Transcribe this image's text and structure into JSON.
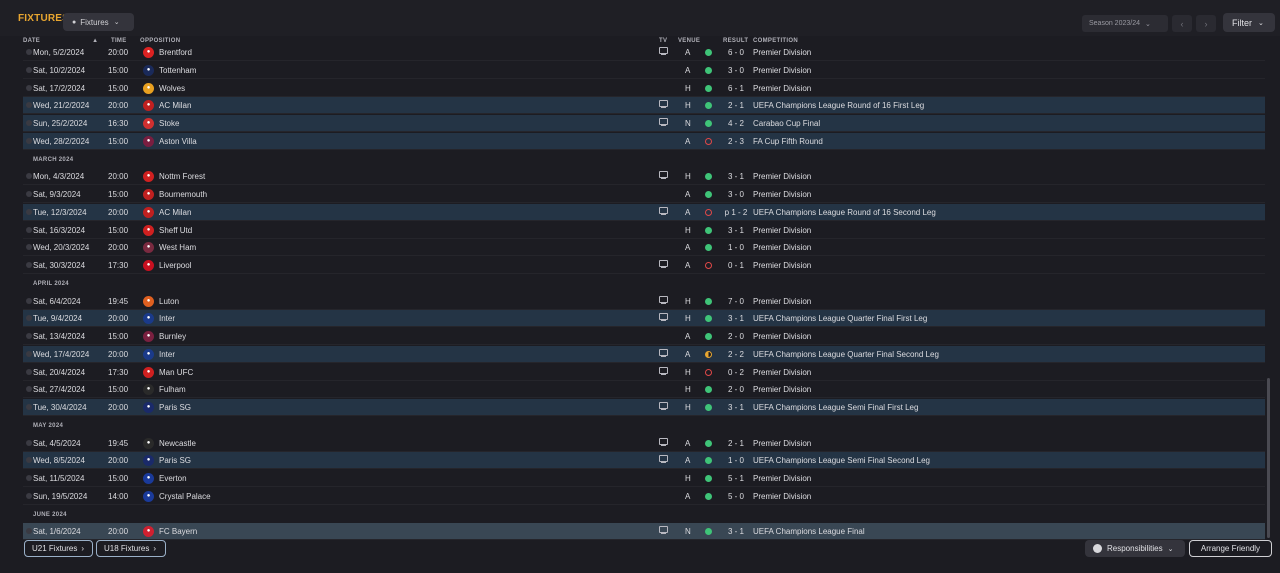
{
  "header": {
    "title": "FIXTURES",
    "view_selector": "Fixtures",
    "season": "Season 2023/24",
    "filter": "Filter"
  },
  "columns": {
    "date": "DATE",
    "time": "TIME",
    "opposition": "OPPOSITION",
    "tv": "TV",
    "venue": "VENUE",
    "result": "RESULT",
    "competition": "COMPETITION"
  },
  "rows": [
    {
      "type": "fixture",
      "date": "Mon, 5/2/2024",
      "time": "20:00",
      "opp": "Brentford",
      "crest": "#d22",
      "venue": "A",
      "result": "win",
      "score": "6 - 0",
      "comp": "Premier Division",
      "tv": true,
      "hl": false
    },
    {
      "type": "fixture",
      "date": "Sat, 10/2/2024",
      "time": "15:00",
      "opp": "Tottenham",
      "crest": "#1a2a5a",
      "venue": "A",
      "result": "win",
      "score": "3 - 0",
      "comp": "Premier Division",
      "tv": false,
      "hl": false
    },
    {
      "type": "fixture",
      "date": "Sat, 17/2/2024",
      "time": "15:00",
      "opp": "Wolves",
      "crest": "#e8a020",
      "venue": "H",
      "result": "win",
      "score": "6 - 1",
      "comp": "Premier Division",
      "tv": false,
      "hl": false
    },
    {
      "type": "fixture",
      "date": "Wed, 21/2/2024",
      "time": "20:00",
      "opp": "AC Milan",
      "crest": "#c02020",
      "venue": "H",
      "result": "win",
      "score": "2 - 1",
      "comp": "UEFA Champions League Round of 16  First Leg",
      "tv": true,
      "hl": true
    },
    {
      "type": "fixture",
      "date": "Sun, 25/2/2024",
      "time": "16:30",
      "opp": "Stoke",
      "crest": "#d03030",
      "venue": "N",
      "result": "win",
      "score": "4 - 2",
      "comp": "Carabao Cup Final",
      "tv": true,
      "hl": true
    },
    {
      "type": "fixture",
      "date": "Wed, 28/2/2024",
      "time": "15:00",
      "opp": "Aston Villa",
      "crest": "#7a1e40",
      "venue": "A",
      "result": "loss",
      "score": "2 - 3",
      "comp": "FA Cup Fifth Round",
      "tv": false,
      "hl": true
    },
    {
      "type": "month",
      "label": "MARCH 2024"
    },
    {
      "type": "fixture",
      "date": "Mon, 4/3/2024",
      "time": "20:00",
      "opp": "Nottm Forest",
      "crest": "#d02020",
      "venue": "H",
      "result": "win",
      "score": "3 - 1",
      "comp": "Premier Division",
      "tv": true,
      "hl": false
    },
    {
      "type": "fixture",
      "date": "Sat, 9/3/2024",
      "time": "15:00",
      "opp": "Bournemouth",
      "crest": "#c02020",
      "venue": "A",
      "result": "win",
      "score": "3 - 0",
      "comp": "Premier Division",
      "tv": false,
      "hl": false
    },
    {
      "type": "fixture",
      "date": "Tue, 12/3/2024",
      "time": "20:00",
      "opp": "AC Milan",
      "crest": "#c02020",
      "venue": "A",
      "result": "loss",
      "score": "p 1 - 2",
      "comp": "UEFA Champions League Round of 16  Second Leg",
      "tv": true,
      "hl": true
    },
    {
      "type": "fixture",
      "date": "Sat, 16/3/2024",
      "time": "15:00",
      "opp": "Sheff Utd",
      "crest": "#d02020",
      "venue": "H",
      "result": "win",
      "score": "3 - 1",
      "comp": "Premier Division",
      "tv": false,
      "hl": false
    },
    {
      "type": "fixture",
      "date": "Wed, 20/3/2024",
      "time": "20:00",
      "opp": "West Ham",
      "crest": "#7a2a40",
      "venue": "A",
      "result": "win",
      "score": "1 - 0",
      "comp": "Premier Division",
      "tv": false,
      "hl": false
    },
    {
      "type": "fixture",
      "date": "Sat, 30/3/2024",
      "time": "17:30",
      "opp": "Liverpool",
      "crest": "#c81020",
      "venue": "A",
      "result": "loss",
      "score": "0 - 1",
      "comp": "Premier Division",
      "tv": true,
      "hl": false
    },
    {
      "type": "month",
      "label": "APRIL 2024"
    },
    {
      "type": "fixture",
      "date": "Sat, 6/4/2024",
      "time": "19:45",
      "opp": "Luton",
      "crest": "#e06020",
      "venue": "H",
      "result": "win",
      "score": "7 - 0",
      "comp": "Premier Division",
      "tv": true,
      "hl": false
    },
    {
      "type": "fixture",
      "date": "Tue, 9/4/2024",
      "time": "20:00",
      "opp": "Inter",
      "crest": "#1a3a8a",
      "venue": "H",
      "result": "win",
      "score": "3 - 1",
      "comp": "UEFA Champions League Quarter Final First Leg",
      "tv": true,
      "hl": true
    },
    {
      "type": "fixture",
      "date": "Sat, 13/4/2024",
      "time": "15:00",
      "opp": "Burnley",
      "crest": "#7a2040",
      "venue": "A",
      "result": "win",
      "score": "2 - 0",
      "comp": "Premier Division",
      "tv": false,
      "hl": false
    },
    {
      "type": "fixture",
      "date": "Wed, 17/4/2024",
      "time": "20:00",
      "opp": "Inter",
      "crest": "#1a3a8a",
      "venue": "A",
      "result": "draw",
      "score": "2 - 2",
      "comp": "UEFA Champions League Quarter Final Second Leg",
      "tv": true,
      "hl": true
    },
    {
      "type": "fixture",
      "date": "Sat, 20/4/2024",
      "time": "17:30",
      "opp": "Man UFC",
      "crest": "#d02020",
      "venue": "H",
      "result": "loss",
      "score": "0 - 2",
      "comp": "Premier Division",
      "tv": true,
      "hl": false
    },
    {
      "type": "fixture",
      "date": "Sat, 27/4/2024",
      "time": "15:00",
      "opp": "Fulham",
      "crest": "#2a2a2a",
      "venue": "H",
      "result": "win",
      "score": "2 - 0",
      "comp": "Premier Division",
      "tv": false,
      "hl": false
    },
    {
      "type": "fixture",
      "date": "Tue, 30/4/2024",
      "time": "20:00",
      "opp": "Paris SG",
      "crest": "#1a2a6a",
      "venue": "H",
      "result": "win",
      "score": "3 - 1",
      "comp": "UEFA Champions League Semi Final First Leg",
      "tv": true,
      "hl": true
    },
    {
      "type": "month",
      "label": "MAY 2024"
    },
    {
      "type": "fixture",
      "date": "Sat, 4/5/2024",
      "time": "19:45",
      "opp": "Newcastle",
      "crest": "#2a2a2a",
      "venue": "A",
      "result": "win",
      "score": "2 - 1",
      "comp": "Premier Division",
      "tv": true,
      "hl": false
    },
    {
      "type": "fixture",
      "date": "Wed, 8/5/2024",
      "time": "20:00",
      "opp": "Paris SG",
      "crest": "#1a2a6a",
      "venue": "A",
      "result": "win",
      "score": "1 - 0",
      "comp": "UEFA Champions League Semi Final Second Leg",
      "tv": true,
      "hl": true
    },
    {
      "type": "fixture",
      "date": "Sat, 11/5/2024",
      "time": "15:00",
      "opp": "Everton",
      "crest": "#1a3a9a",
      "venue": "H",
      "result": "win",
      "score": "5 - 1",
      "comp": "Premier Division",
      "tv": false,
      "hl": false
    },
    {
      "type": "fixture",
      "date": "Sun, 19/5/2024",
      "time": "14:00",
      "opp": "Crystal Palace",
      "crest": "#1a3a9a",
      "venue": "A",
      "result": "win",
      "score": "5 - 0",
      "comp": "Premier Division",
      "tv": false,
      "hl": false
    },
    {
      "type": "month",
      "label": "JUNE 2024"
    },
    {
      "type": "fixture",
      "date": "Sat, 1/6/2024",
      "time": "20:00",
      "opp": "FC Bayern",
      "crest": "#d02030",
      "venue": "N",
      "result": "win",
      "score": "3 - 1",
      "comp": "UEFA Champions League Final",
      "tv": true,
      "hl": false,
      "last": true
    }
  ],
  "footer": {
    "u21": "U21 Fixtures",
    "u18": "U18 Fixtures",
    "responsibilities": "Responsibilities",
    "arrange": "Arrange Friendly"
  }
}
